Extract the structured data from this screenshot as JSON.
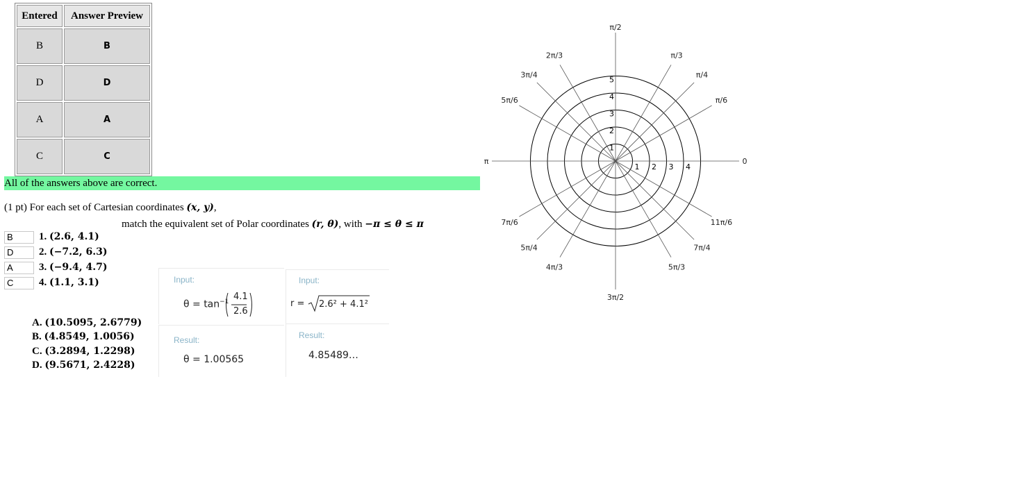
{
  "results_table": {
    "headers": [
      "Entered",
      "Answer Preview"
    ],
    "rows": [
      {
        "entered": "B",
        "preview": "B"
      },
      {
        "entered": "D",
        "preview": "D"
      },
      {
        "entered": "A",
        "preview": "A"
      },
      {
        "entered": "C",
        "preview": "C"
      }
    ]
  },
  "banner": {
    "text": "All of the answers above are correct.",
    "color": "#74f7a0"
  },
  "question": {
    "line1_prefix": "(1 pt) For each set of Cartesian coordinates ",
    "line1_math": "(x, y)",
    "line1_suffix": ",",
    "line2_prefix": "match the equivalent set of Polar coordinates ",
    "line2_math": "(r, θ)",
    "line2_mid": ", with ",
    "line2_math2": "−π ≤ θ ≤ π"
  },
  "items": [
    {
      "answer": "B",
      "num": "1.",
      "coords": "(2.6, 4.1)"
    },
    {
      "answer": "D",
      "num": "2.",
      "coords": "(−7.2, 6.3)"
    },
    {
      "answer": "A",
      "num": "3.",
      "coords": "(−9.4, 4.7)"
    },
    {
      "answer": "C",
      "num": "4.",
      "coords": "(1.1, 3.1)"
    }
  ],
  "options": [
    {
      "letter": "A.",
      "value": "(10.5095, 2.6779)"
    },
    {
      "letter": "B.",
      "value": "(4.8549, 1.0056)"
    },
    {
      "letter": "C.",
      "value": "(3.2894, 1.2298)"
    },
    {
      "letter": "D.",
      "value": "(9.5671, 2.4228)"
    }
  ],
  "wolfram": {
    "left": {
      "input_label": "Input:",
      "input_prefix": "θ = tan",
      "input_sup": "−1",
      "frac_num": "4.1",
      "frac_den": "2.6",
      "result_label": "Result:",
      "result_value": "θ = 1.00565"
    },
    "right": {
      "input_label": "Input:",
      "input_prefix": "r =",
      "radicand": "2.6² + 4.1²",
      "result_label": "Result:",
      "result_value": "4.85489…"
    }
  },
  "polar_chart": {
    "angle_labels": [
      "0",
      "π/6",
      "π/4",
      "π/3",
      "π/2",
      "2π/3",
      "3π/4",
      "5π/6",
      "π",
      "7π/6",
      "5π/4",
      "4π/3",
      "3π/2",
      "5π/3",
      "7π/4",
      "11π/6"
    ],
    "ring_labels_vertical": [
      "1",
      "2",
      "3",
      "4",
      "5"
    ],
    "ring_labels_horizontal": [
      "1",
      "2",
      "3",
      "4"
    ]
  }
}
